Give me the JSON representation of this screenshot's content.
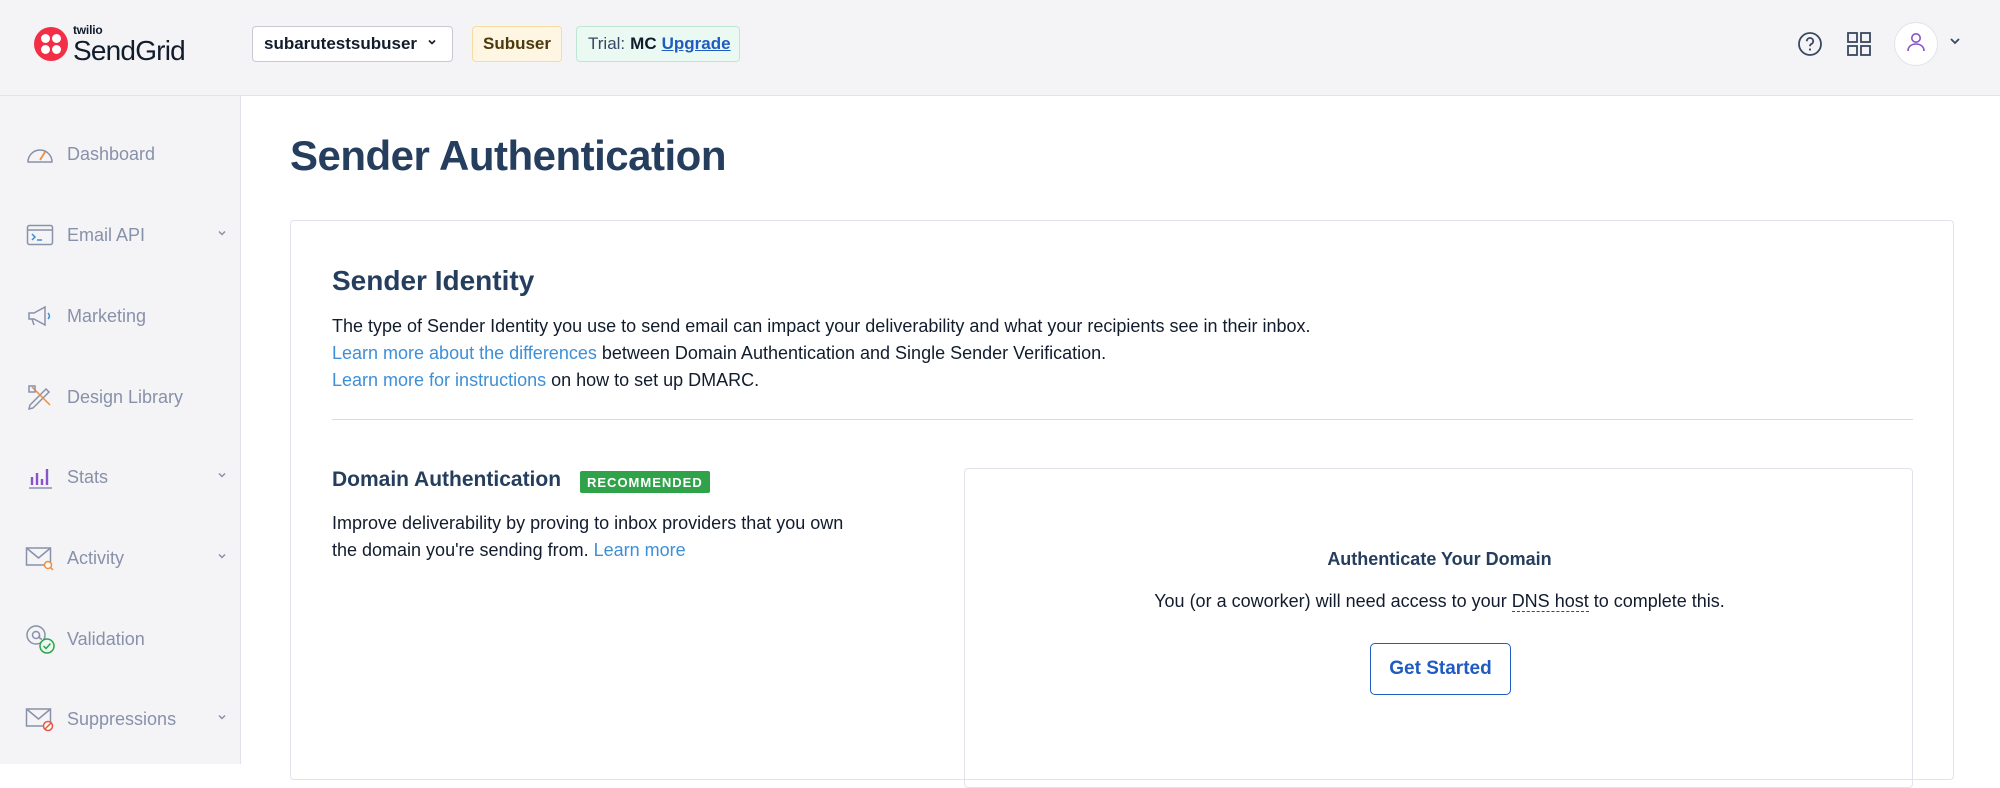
{
  "topbar": {
    "logo_small": "twilio",
    "logo_big": "SendGrid",
    "account": "subarutestsubuser",
    "subuser_badge": "Subuser",
    "trial_label": "Trial:",
    "trial_plan": "MC",
    "upgrade_link": "Upgrade",
    "icons": [
      "help-icon",
      "app-switcher-icon",
      "user-icon",
      "chevron-down-icon"
    ]
  },
  "sidebar": {
    "items": [
      {
        "label": "Dashboard",
        "icon": "dashboard-icon",
        "has_children": false
      },
      {
        "label": "Email API",
        "icon": "email-api-icon",
        "has_children": true
      },
      {
        "label": "Marketing",
        "icon": "megaphone-icon",
        "has_children": false
      },
      {
        "label": "Design Library",
        "icon": "design-icon",
        "has_children": false
      },
      {
        "label": "Stats",
        "icon": "stats-icon",
        "has_children": true
      },
      {
        "label": "Activity",
        "icon": "activity-icon",
        "has_children": true
      },
      {
        "label": "Validation",
        "icon": "validation-icon",
        "has_children": false
      },
      {
        "label": "Suppressions",
        "icon": "suppressions-icon",
        "has_children": true
      }
    ]
  },
  "main": {
    "page_title": "Sender Authentication",
    "sender_identity": {
      "title": "Sender Identity",
      "line1": "The type of Sender Identity you use to send email can impact your deliverability and what your recipients see in their inbox.",
      "link1": "Learn more about the differences",
      "line2_rest": " between Domain Authentication and Single Sender Verification.",
      "link2": "Learn more for instructions",
      "line3_rest": " on how to set up DMARC."
    },
    "domain_auth": {
      "title": "Domain Authentication",
      "badge": "RECOMMENDED",
      "desc": "Improve deliverability by proving to inbox providers that you own the domain you're sending from.",
      "learn_more": "Learn more",
      "box_title": "Authenticate Your Domain",
      "box_sub_before": "You (or a coworker) will need access to your ",
      "box_sub_dns": "DNS host",
      "box_sub_after": " to complete this.",
      "button": "Get Started"
    }
  },
  "colors": {
    "brand_red": "#f22f46",
    "link_blue": "#3d8fd8",
    "button_blue": "#1f5bc1",
    "recommended_green": "#30a34a"
  }
}
